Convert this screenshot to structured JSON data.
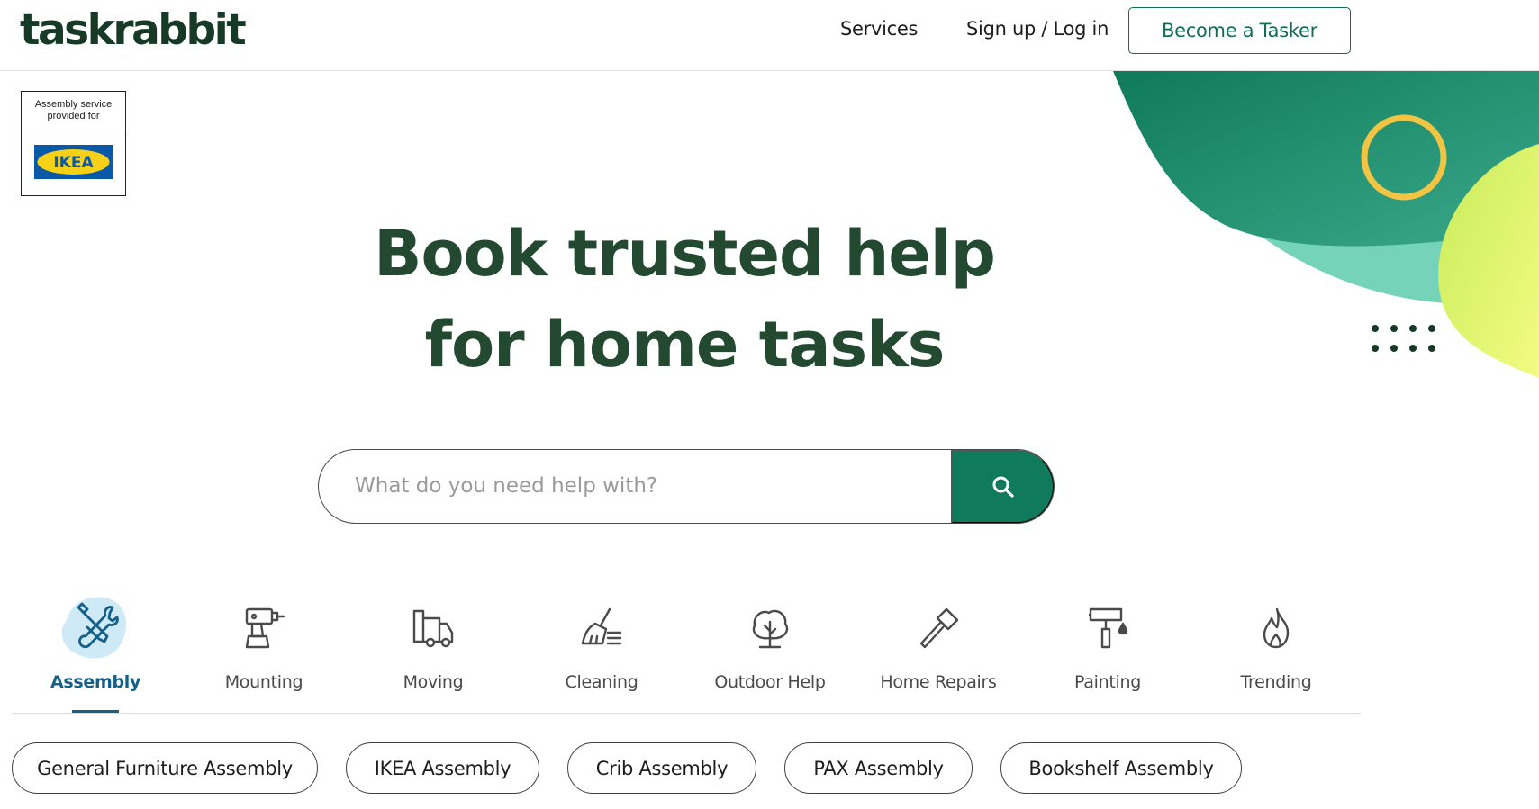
{
  "header": {
    "logo": "taskrabbit",
    "nav": {
      "services": "Services",
      "signup_login": "Sign up / Log in"
    },
    "become_tasker": "Become a Tasker"
  },
  "badge": {
    "caption": "Assembly service provided for",
    "brand": "IKEA"
  },
  "hero": {
    "line1": "Book trusted help",
    "line2": "for home tasks"
  },
  "search": {
    "placeholder": "What do you need help with?",
    "icon": "search-icon"
  },
  "categories": [
    {
      "label": "Assembly",
      "icon": "wrench-screwdriver-icon",
      "active": true
    },
    {
      "label": "Mounting",
      "icon": "drill-icon"
    },
    {
      "label": "Moving",
      "icon": "moving-truck-icon"
    },
    {
      "label": "Cleaning",
      "icon": "broom-icon"
    },
    {
      "label": "Outdoor Help",
      "icon": "tree-icon"
    },
    {
      "label": "Home Repairs",
      "icon": "hammer-icon"
    },
    {
      "label": "Painting",
      "icon": "paint-roller-icon"
    },
    {
      "label": "Trending",
      "icon": "flame-icon"
    }
  ],
  "chips": [
    "General Furniture Assembly",
    "IKEA Assembly",
    "Crib Assembly",
    "PAX Assembly",
    "Bookshelf Assembly"
  ],
  "colors": {
    "brand_green": "#107a5d",
    "title_green": "#234a30",
    "active_blue": "#13608a",
    "ikea_blue": "#0a58a8",
    "ikea_yellow": "#f7d117"
  }
}
